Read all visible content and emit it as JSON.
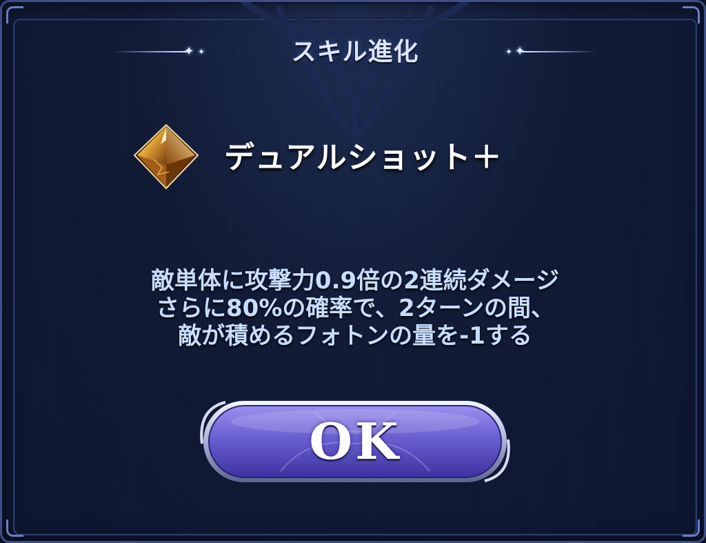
{
  "dialog": {
    "title": "スキル進化",
    "title_ornament_icon": "sparkle-diamond-icon",
    "skill": {
      "icon": "amber-crystal-gem-icon",
      "name": "デュアルショット＋"
    },
    "description_lines": [
      "敵単体に攻撃力0.9倍の2連続ダメージ",
      "さらに80%の確率で、2ターンの間、",
      "敵が積めるフォトンの量を-1する"
    ],
    "ok_label": "OK"
  },
  "colors": {
    "background": "#0c1530",
    "border": "#3d4f86",
    "title_text": "#dde6ff",
    "description_text": "#c8ddff",
    "button_fill": "#6a5fd0",
    "gem": "#d99a2b"
  }
}
